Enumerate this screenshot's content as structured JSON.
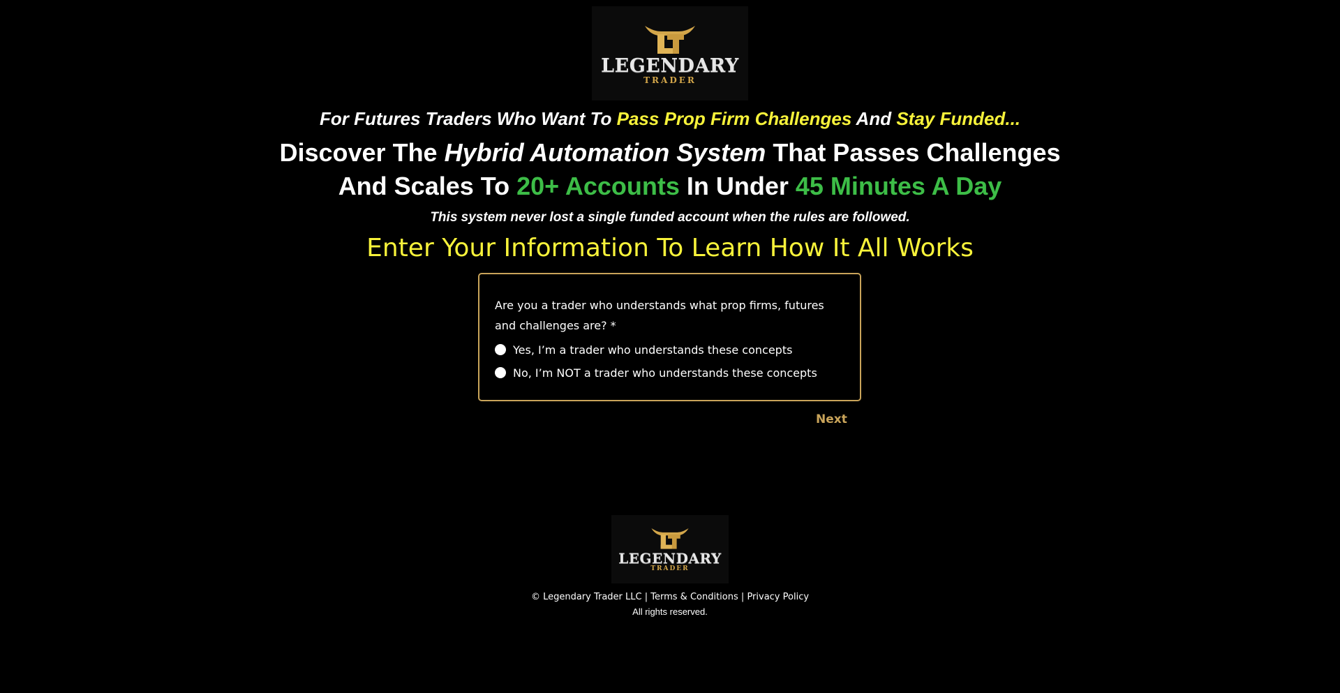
{
  "logo": {
    "word": "LEGENDARY",
    "sub": "TRADER",
    "accent_color": "#d3a64a"
  },
  "hero": {
    "pre_headline": {
      "part1": "For Futures Traders Who Want To ",
      "highlight1": "Pass Prop Firm Challenges",
      "part2": " And ",
      "highlight2": "Stay Funded..."
    },
    "headline": {
      "line1_part1": "Discover The ",
      "line1_em": "Hybrid Automation System",
      "line1_part2": " That Passes Challenges",
      "line2_part1": "And Scales To ",
      "line2_green1": "20+ Accounts",
      "line2_part2": " In Under ",
      "line2_green2": "45 Minutes A Day"
    },
    "disclaimer": "This system never lost a single funded account when the rules are followed.",
    "cta_heading": "Enter Your Information To Learn How It All Works"
  },
  "form": {
    "question": "Are you a trader who understands what prop firms, futures and challenges are? *",
    "options": [
      "Yes, I’m a trader who understands these concepts",
      "No, I’m NOT a trader who understands these concepts"
    ],
    "next_label": "Next",
    "border_color": "#c9a45a"
  },
  "footer": {
    "copyright": "© Legendary Trader LLC",
    "separator": "|",
    "terms": "Terms & Conditions",
    "privacy": "Privacy Policy",
    "rights": "All rights reserved."
  },
  "colors": {
    "yellow": "#f7f23a",
    "green": "#3dbd47",
    "background": "#000000"
  }
}
